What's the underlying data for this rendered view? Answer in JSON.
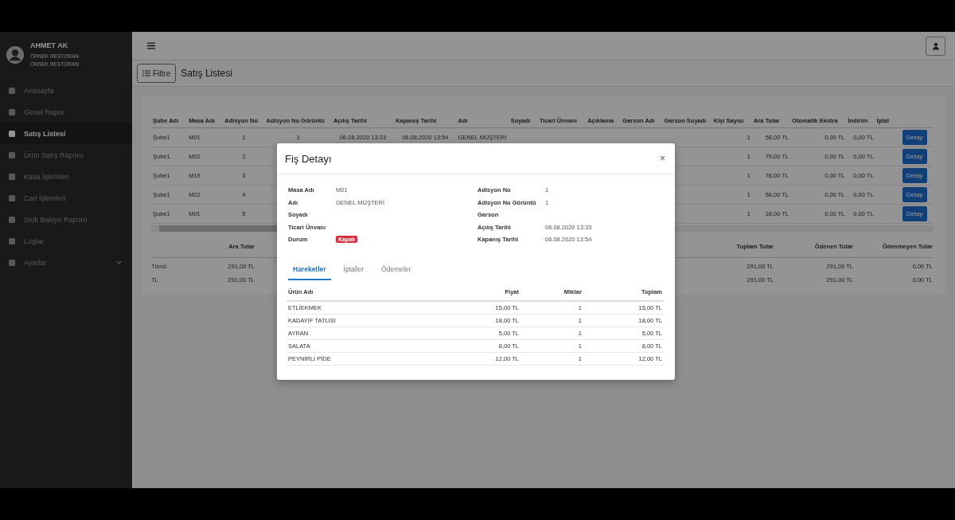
{
  "sidebar": {
    "user": {
      "name": "AHMET AK",
      "lines": [
        "ÖRNEK RESTORAN",
        "ÖRNEK RESTORAN"
      ]
    },
    "items": [
      {
        "label": "Anasayfa",
        "selected": false,
        "submenu": false
      },
      {
        "label": "Genel Rapor",
        "selected": false,
        "submenu": false
      },
      {
        "label": "Satış Listesi",
        "selected": true,
        "submenu": false
      },
      {
        "label": "Ürün Satış Raporu",
        "selected": false,
        "submenu": false
      },
      {
        "label": "Kasa İşlemleri",
        "selected": false,
        "submenu": false
      },
      {
        "label": "Cari İşlemleri",
        "selected": false,
        "submenu": false
      },
      {
        "label": "Stok Bakiye Raporu",
        "selected": false,
        "submenu": false
      },
      {
        "label": "Loglar",
        "selected": false,
        "submenu": false
      },
      {
        "label": "Ayarlar",
        "selected": false,
        "submenu": true
      }
    ]
  },
  "toolbar": {
    "filter_button": "Filtre",
    "title": "Satış Listesi"
  },
  "table": {
    "columns": [
      "Şube Adı",
      "Masa Adı",
      "Adisyon No",
      "Adisyon No Görüntü",
      "Açılış Tarihi",
      "Kapanış Tarihi",
      "Adı",
      "Soyadı",
      "Ticari Ünvanı",
      "Açıklama",
      "Garson Adı",
      "Garson Soyadı",
      "Kişi Sayısı",
      "Ara Tutar",
      "Otomatik Ekstra",
      "İndirim",
      "İptal"
    ],
    "rows": [
      {
        "cells": [
          "Şube1",
          "M01",
          "1",
          "1",
          "06.08.2020 13:33",
          "06.08.2020 13:54",
          "GENEL MÜŞTERİ",
          null,
          null,
          null,
          null,
          null,
          "1",
          "58,00 TL",
          "0,00 TL",
          "0,00 TL",
          null
        ],
        "action": "Detay"
      },
      {
        "cells": [
          "Şube1",
          "M02",
          "2",
          null,
          null,
          null,
          null,
          null,
          null,
          null,
          null,
          null,
          "1",
          "79,00 TL",
          "0,00 TL",
          "0,00 TL",
          null
        ],
        "action": "Detay"
      },
      {
        "cells": [
          "Şube1",
          "M19",
          "3",
          null,
          null,
          null,
          null,
          null,
          null,
          null,
          null,
          null,
          "1",
          "78,00 TL",
          "0,00 TL",
          "0,00 TL",
          null
        ],
        "action": "Detay"
      },
      {
        "cells": [
          "Şube1",
          "M22",
          "4",
          null,
          null,
          null,
          null,
          null,
          null,
          null,
          null,
          null,
          "1",
          "58,00 TL",
          "0,00 TL",
          "0,00 TL",
          null
        ],
        "action": "Detay"
      },
      {
        "cells": [
          "Şube1",
          "M01",
          "5",
          null,
          null,
          null,
          null,
          null,
          null,
          null,
          null,
          null,
          "1",
          "18,00 TL",
          "0,00 TL",
          "0,00 TL",
          null
        ],
        "action": "Detay"
      }
    ]
  },
  "summary": {
    "left_columns": [
      "Ara Tutar"
    ],
    "right_columns": [
      "Toplam Tutar",
      "Ödenen Tutar",
      "Ödenmeyen Tutar"
    ],
    "rows": [
      {
        "label": "Tümü",
        "left": [
          "291,00 TL"
        ],
        "right": [
          "291,00 TL",
          "291,00 TL",
          "0,00 TL"
        ]
      },
      {
        "label": "TL",
        "left": [
          "291,00 TL"
        ],
        "right": [
          "291,00 TL",
          "291,00 TL",
          "0,00 TL"
        ]
      }
    ]
  },
  "modal": {
    "title": "Fiş Detayı",
    "close": "×",
    "left_fields": [
      {
        "label": "Masa Adı",
        "value": "M01",
        "kind": "text"
      },
      {
        "label": "Adı",
        "value": "GENEL MÜŞTERİ",
        "kind": "text"
      },
      {
        "label": "Soyadı"
      },
      {
        "label": "Ticari Ünvanı"
      },
      {
        "label": "Durum",
        "value": "Kapalı",
        "kind": "badge"
      }
    ],
    "right_fields": [
      {
        "label": "Adisyon No",
        "value": "1",
        "kind": "text"
      },
      {
        "label": "Adisyon No Görüntü",
        "value": "1",
        "kind": "text"
      },
      {
        "label": "Garson"
      },
      {
        "label": "Açılış Tarihi",
        "value": "06.08.2020 13:33",
        "kind": "text"
      },
      {
        "label": "Kapanış Tarihi",
        "value": "06.08.2020 13:54",
        "kind": "text"
      }
    ],
    "tabs": [
      {
        "label": "Hareketler",
        "selected": true
      },
      {
        "label": "İptaller",
        "selected": false
      },
      {
        "label": "Ödemeler",
        "selected": false
      }
    ],
    "items": {
      "columns": [
        "Ürün Adı",
        "Fiyat",
        "Miktar",
        "Toplam"
      ],
      "rows": [
        [
          "ETLİEKMEK",
          "15,00 TL",
          "1",
          "15,00 TL"
        ],
        [
          "KADAYIF TATLISI",
          "18,00 TL",
          "1",
          "18,00 TL"
        ],
        [
          "AYRAN",
          "5,00 TL",
          "1",
          "5,00 TL"
        ],
        [
          "SALATA",
          "8,00 TL",
          "1",
          "8,00 TL"
        ],
        [
          "PEYNİRLİ PİDE",
          "12,00 TL",
          "1",
          "12,00 TL"
        ]
      ]
    }
  }
}
